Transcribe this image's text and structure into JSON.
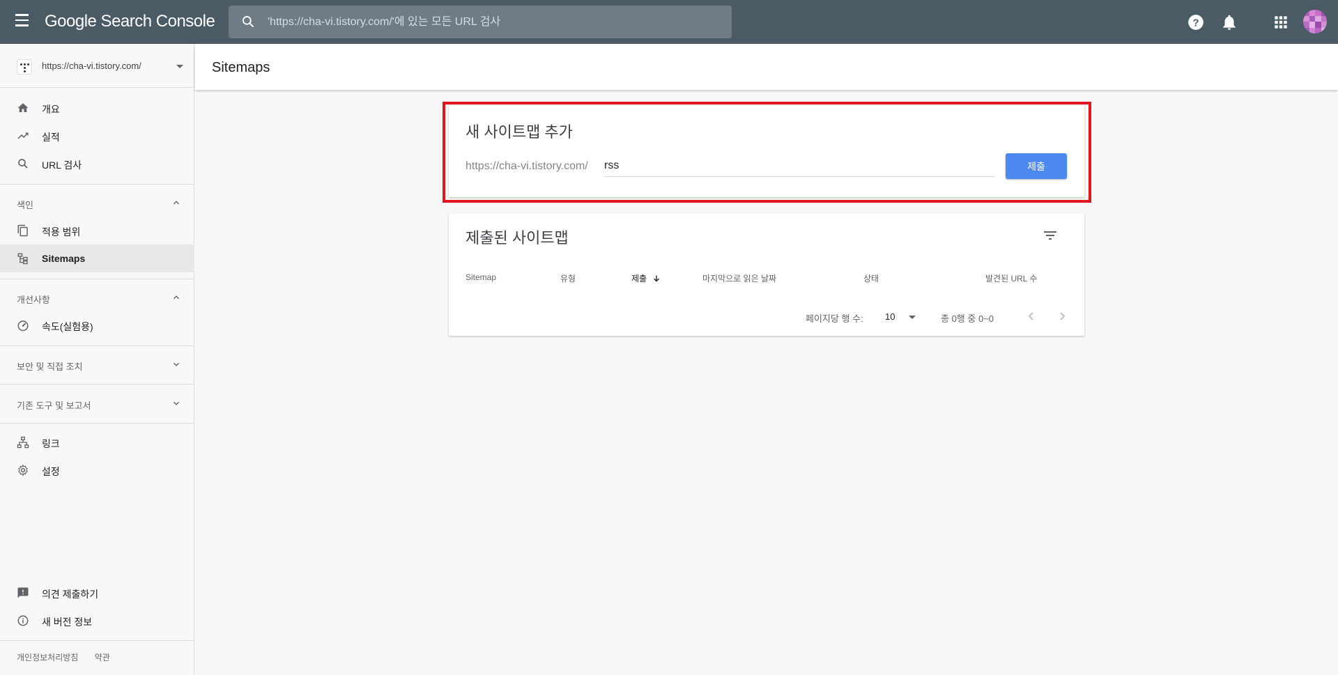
{
  "app": {
    "logo": "Google Search Console"
  },
  "search": {
    "placeholder": "'https://cha-vi.tistory.com/'에 있는 모든 URL 검사"
  },
  "property": {
    "url": "https://cha-vi.tistory.com/"
  },
  "sidebar": {
    "items_top": [
      {
        "label": "개요",
        "icon": "home-icon"
      },
      {
        "label": "실적",
        "icon": "trending-up-icon"
      },
      {
        "label": "URL 검사",
        "icon": "search-icon"
      }
    ],
    "section_index": {
      "label": "색인",
      "expanded": true
    },
    "items_index": [
      {
        "label": "적용 범위",
        "icon": "copy-icon"
      },
      {
        "label": "Sitemaps",
        "icon": "sitemap-icon",
        "active": true
      }
    ],
    "section_enhancements": {
      "label": "개선사항",
      "expanded": true
    },
    "items_enh": [
      {
        "label": "속도(실험용)",
        "icon": "speed-gauge-icon"
      }
    ],
    "section_security": {
      "label": "보안 및 직접 조치",
      "expanded": false
    },
    "section_legacy": {
      "label": "기존 도구 및 보고서",
      "expanded": false
    },
    "items_bottom": [
      {
        "label": "링크",
        "icon": "links-icon"
      },
      {
        "label": "설정",
        "icon": "gear-icon"
      }
    ],
    "items_footer": [
      {
        "label": "의견 제출하기",
        "icon": "feedback-icon"
      },
      {
        "label": "새 버전 정보",
        "icon": "info-icon"
      }
    ],
    "footer_links": [
      "개인정보처리방침",
      "약관"
    ]
  },
  "page": {
    "title": "Sitemaps"
  },
  "add_sitemap": {
    "title": "새 사이트맵 추가",
    "prefix": "https://cha-vi.tistory.com/",
    "value": "rss",
    "submit_label": "제출"
  },
  "submitted": {
    "title": "제출된 사이트맵",
    "columns": [
      "Sitemap",
      "유형",
      "제출",
      "마지막으로 읽은 날짜",
      "상태",
      "발견된 URL 수"
    ],
    "rows_per_page_label": "페이지당 행 수:",
    "rows_per_page": "10",
    "range": "총 0행 중 0~0"
  },
  "colors": {
    "topbar": "#4b5b66",
    "accent": "#4d8af0",
    "highlight": "#e0151f"
  }
}
